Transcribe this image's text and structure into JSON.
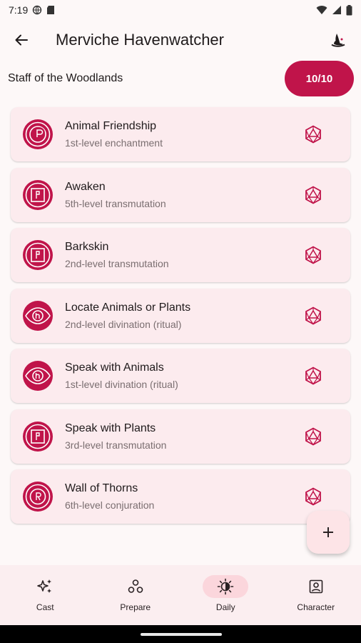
{
  "status": {
    "time": "7:19"
  },
  "app_bar": {
    "title": "Merviche Havenwatcher"
  },
  "item": {
    "name": "Staff of the Woodlands",
    "charges": "10/10"
  },
  "spells": [
    {
      "name": "Animal Friendship",
      "sub": "1st-level enchantment",
      "icon": "enchantment-icon"
    },
    {
      "name": "Awaken",
      "sub": "5th-level transmutation",
      "icon": "transmutation-icon"
    },
    {
      "name": "Barkskin",
      "sub": "2nd-level transmutation",
      "icon": "transmutation-icon"
    },
    {
      "name": "Locate Animals or Plants",
      "sub": "2nd-level divination (ritual)",
      "icon": "divination-icon"
    },
    {
      "name": "Speak with Animals",
      "sub": "1st-level divination (ritual)",
      "icon": "divination-icon"
    },
    {
      "name": "Speak with Plants",
      "sub": "3rd-level transmutation",
      "icon": "transmutation-icon"
    },
    {
      "name": "Wall of Thorns",
      "sub": "6th-level conjuration",
      "icon": "conjuration-icon"
    }
  ],
  "nav": [
    {
      "label": "Cast",
      "icon": "sparkles-icon",
      "active": false
    },
    {
      "label": "Prepare",
      "icon": "circles-icon",
      "active": false
    },
    {
      "label": "Daily",
      "icon": "day-night-icon",
      "active": true
    },
    {
      "label": "Character",
      "icon": "character-portrait-icon",
      "active": false
    }
  ],
  "colors": {
    "accent": "#c0144a",
    "card": "#fcebee",
    "nav_bg": "#fbeef0",
    "nav_active": "#fbd6dc"
  }
}
